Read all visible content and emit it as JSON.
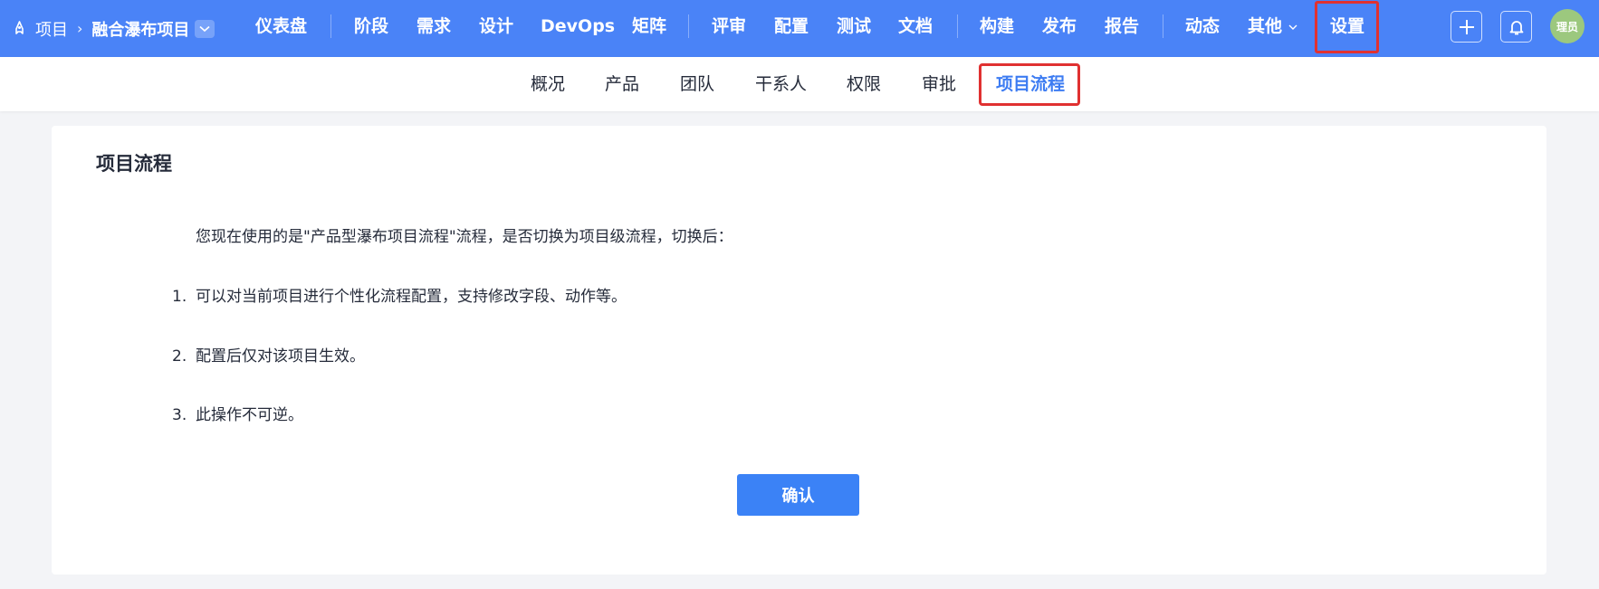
{
  "breadcrumb": {
    "root": "项目",
    "project": "融合瀑布项目"
  },
  "nav": {
    "dashboard": "仪表盘",
    "stage": "阶段",
    "requirement": "需求",
    "design": "设计",
    "devops": "DevOps",
    "matrix": "矩阵",
    "review": "评审",
    "config": "配置",
    "test": "测试",
    "docs": "文档",
    "build": "构建",
    "release": "发布",
    "report": "报告",
    "activity": "动态",
    "more": "其他",
    "settings": "设置"
  },
  "user": {
    "avatar_text": "理员"
  },
  "subtabs": {
    "overview": "概况",
    "product": "产品",
    "team": "团队",
    "stakeholders": "干系人",
    "permissions": "权限",
    "approval": "审批",
    "project_flow": "项目流程"
  },
  "content": {
    "title": "项目流程",
    "intro": "您现在使用的是\"产品型瀑布项目流程\"流程，是否切换为项目级流程，切换后：",
    "items": [
      {
        "num": "1.",
        "text": "可以对当前项目进行个性化流程配置，支持修改字段、动作等。"
      },
      {
        "num": "2.",
        "text": "配置后仅对该项目生效。"
      },
      {
        "num": "3.",
        "text": "此操作不可逆。"
      }
    ],
    "confirm": "确认"
  },
  "colors": {
    "topbar": "#4a83f7",
    "accent": "#3b82f6",
    "highlight": "#e03131",
    "avatar": "#9cc87e"
  }
}
